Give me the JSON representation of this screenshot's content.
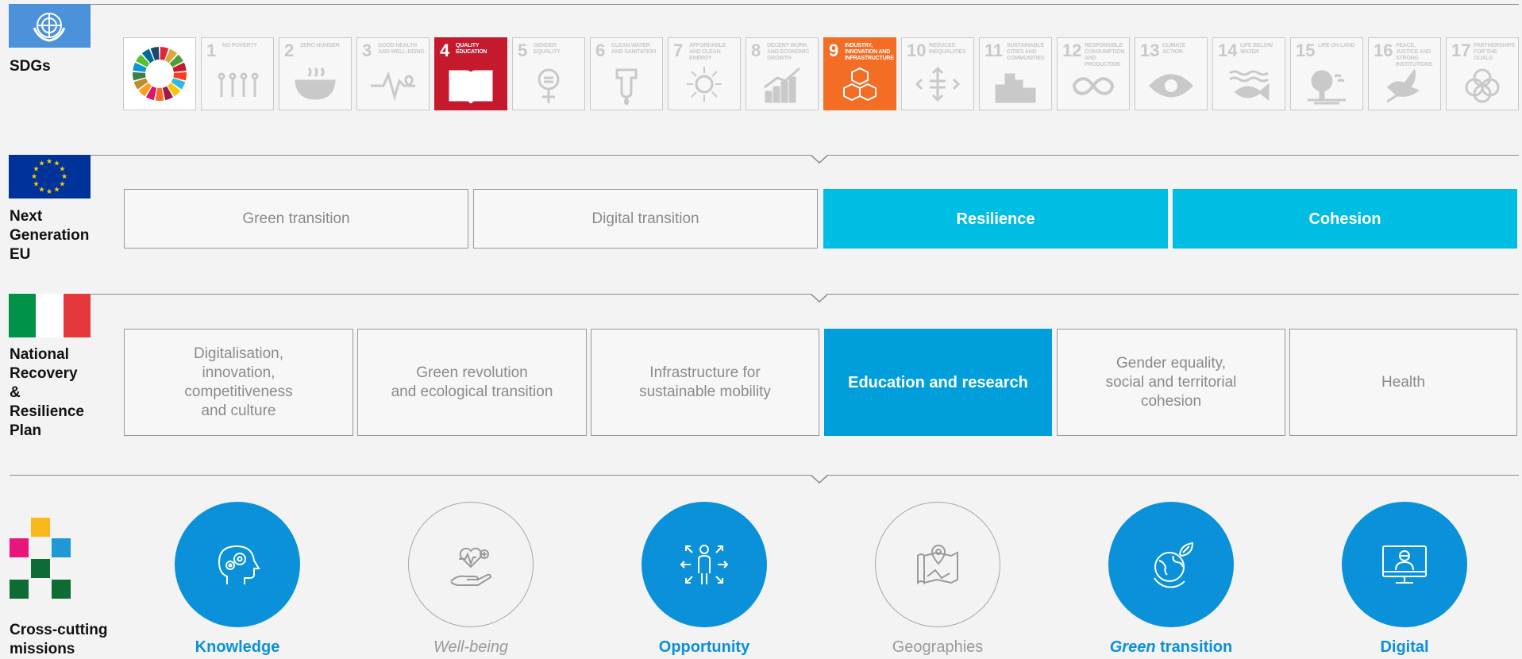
{
  "rows": {
    "sdgs": {
      "label": "SDGs"
    },
    "ngeu": {
      "label_lines": [
        "Next",
        "Generation",
        "EU"
      ]
    },
    "pnrr": {
      "label_lines": [
        "National",
        "Recovery",
        "&",
        "Resilience",
        "Plan"
      ]
    },
    "missions": {
      "label_lines": [
        "Cross-cutting",
        "missions"
      ]
    }
  },
  "sdg_goals": [
    {
      "num": "1",
      "title": "No poverty",
      "icon": "people-icon",
      "active": false
    },
    {
      "num": "2",
      "title": "Zero hunger",
      "icon": "bowl-icon",
      "active": false
    },
    {
      "num": "3",
      "title": "Good health and well-being",
      "icon": "heartbeat-icon",
      "active": false
    },
    {
      "num": "4",
      "title": "Quality education",
      "icon": "book-icon",
      "active": true,
      "color": "#c5192d"
    },
    {
      "num": "5",
      "title": "Gender equality",
      "icon": "gender-icon",
      "active": false
    },
    {
      "num": "6",
      "title": "Clean water and sanitation",
      "icon": "water-icon",
      "active": false
    },
    {
      "num": "7",
      "title": "Affordable and clean energy",
      "icon": "sun-icon",
      "active": false
    },
    {
      "num": "8",
      "title": "Decent work and economic growth",
      "icon": "growth-icon",
      "active": false
    },
    {
      "num": "9",
      "title": "Industry, innovation and infrastructure",
      "icon": "cubes-icon",
      "active": true,
      "color": "#f36d25"
    },
    {
      "num": "10",
      "title": "Reduced inequalities",
      "icon": "arrows-icon",
      "active": false
    },
    {
      "num": "11",
      "title": "Sustainable cities and communities",
      "icon": "city-icon",
      "active": false
    },
    {
      "num": "12",
      "title": "Responsible consumption and production",
      "icon": "infinity-icon",
      "active": false
    },
    {
      "num": "13",
      "title": "Climate action",
      "icon": "eye-icon",
      "active": false
    },
    {
      "num": "14",
      "title": "Life below water",
      "icon": "fish-icon",
      "active": false
    },
    {
      "num": "15",
      "title": "Life on land",
      "icon": "tree-icon",
      "active": false
    },
    {
      "num": "16",
      "title": "Peace, justice and strong institutions",
      "icon": "dove-icon",
      "active": false
    },
    {
      "num": "17",
      "title": "Partnerships for the goals",
      "icon": "rings-icon",
      "active": false
    }
  ],
  "ngeu_pillars": [
    {
      "label": "Green transition",
      "active": false
    },
    {
      "label": "Digital transition",
      "active": false
    },
    {
      "label": "Resilience",
      "active": true
    },
    {
      "label": "Cohesion",
      "active": true
    }
  ],
  "pnrr_missions": [
    {
      "lines": [
        "Digitalisation,",
        "innovation,",
        "competitiveness",
        "and culture"
      ],
      "active": false
    },
    {
      "lines": [
        "Green revolution",
        "and ecological transition"
      ],
      "active": false
    },
    {
      "lines": [
        "Infrastructure for",
        "sustainable mobility"
      ],
      "active": false
    },
    {
      "lines": [
        "Education and research"
      ],
      "active": true
    },
    {
      "lines": [
        "Gender equality,",
        "social and territorial",
        "cohesion"
      ],
      "active": false
    },
    {
      "lines": [
        "Health"
      ],
      "active": false
    }
  ],
  "cross_missions": [
    {
      "label": "Knowledge",
      "icon": "head-gears-icon",
      "active": true
    },
    {
      "label": "Well-being",
      "icon": "heart-hand-icon",
      "active": false,
      "italic": true
    },
    {
      "label": "Opportunity",
      "icon": "person-arrows-icon",
      "active": true
    },
    {
      "label": "Geographies",
      "icon": "map-pin-icon",
      "active": false
    },
    {
      "label_em": "Green",
      "label_rest": " transition",
      "icon": "globe-leaf-icon",
      "active": true
    },
    {
      "label": "Digital",
      "icon": "monitor-person-icon",
      "active": true
    }
  ],
  "colors": {
    "active_blue": "#0a91d9",
    "ngeu_active": "#00bde4",
    "pnrr_active": "#009fdc",
    "sdg4": "#c5192d",
    "sdg9": "#f36d25",
    "inactive_text": "#8a8a8a"
  }
}
